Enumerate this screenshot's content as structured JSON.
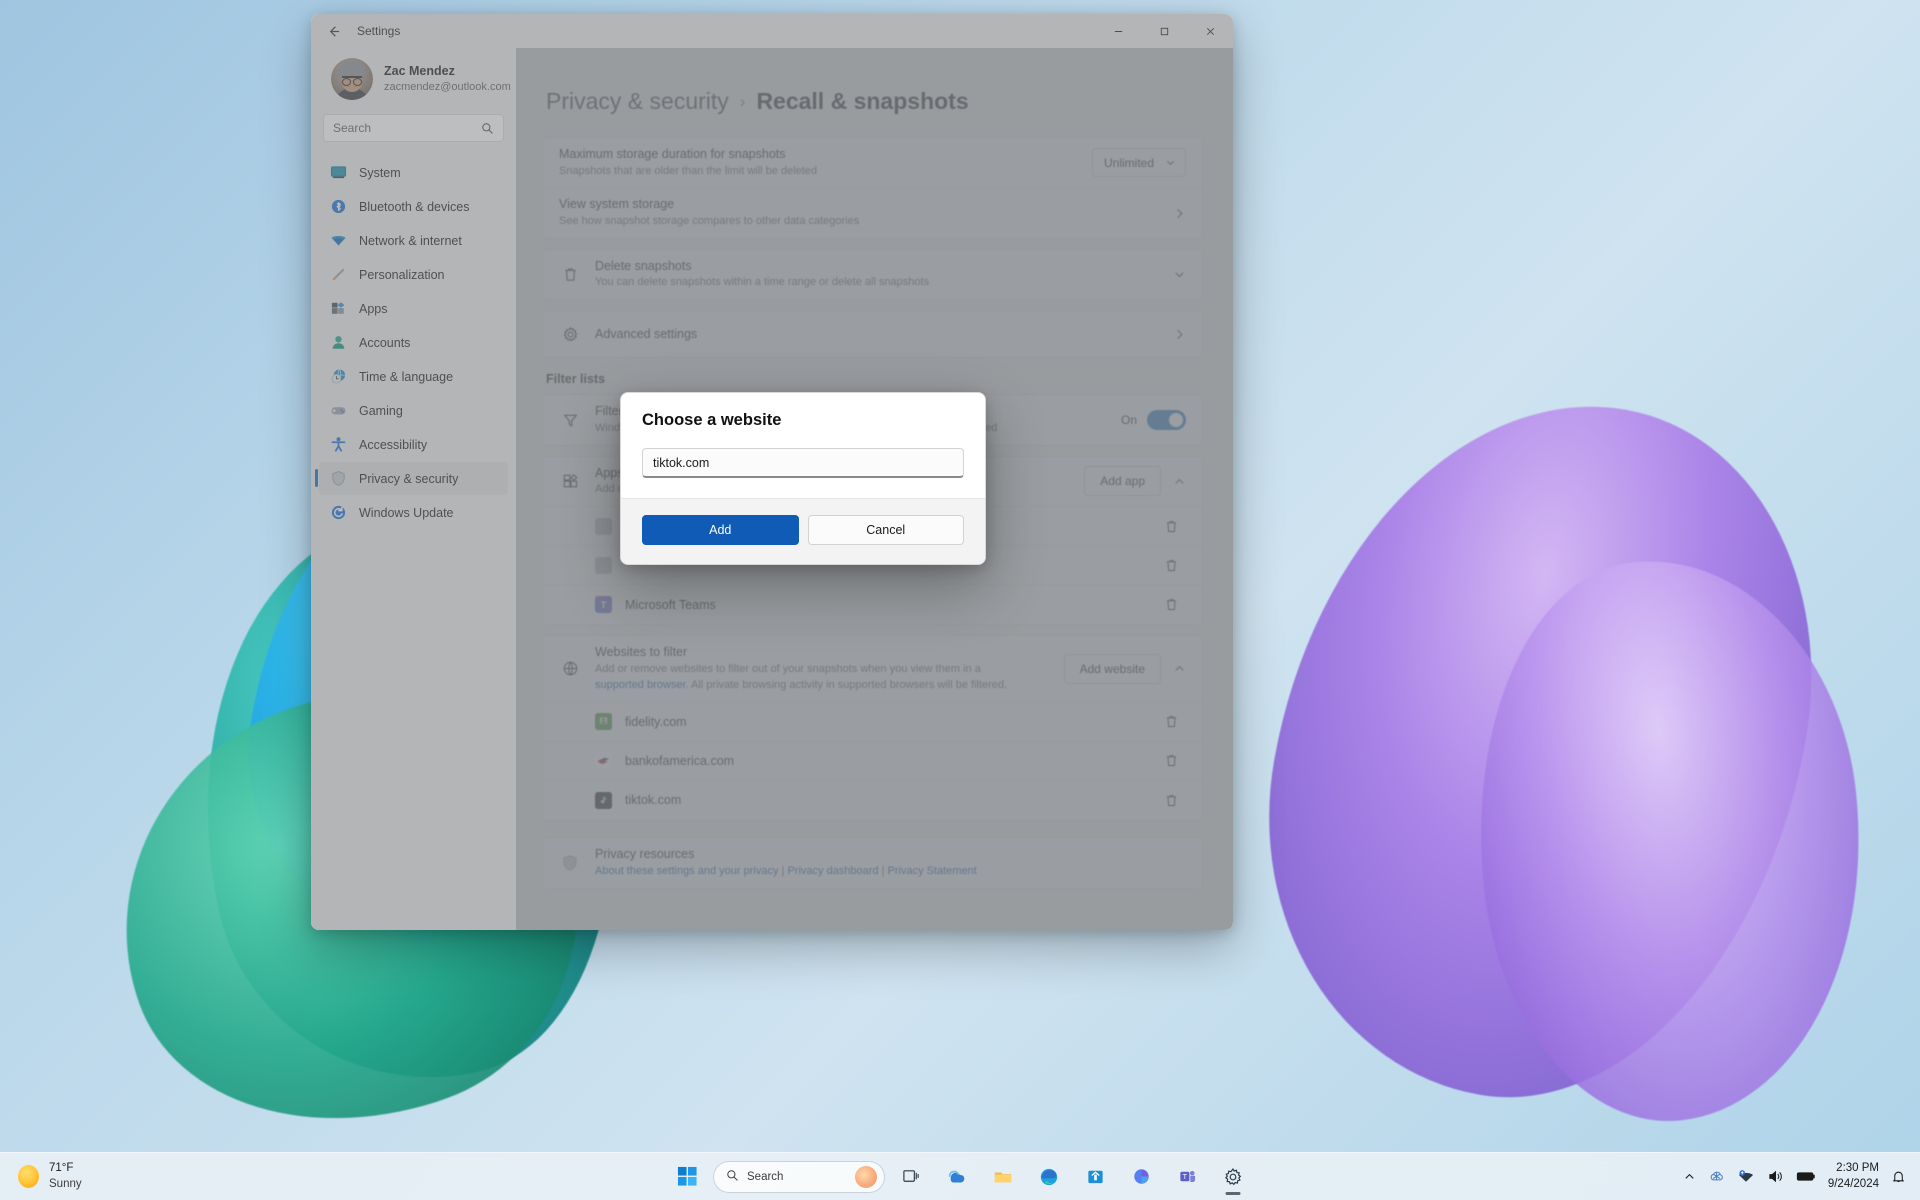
{
  "window": {
    "title": "Settings",
    "back_icon": "back-arrow-icon",
    "minimize_label": "–",
    "maximize_label": "□",
    "close_label": "✕"
  },
  "account": {
    "name": "Zac Mendez",
    "email": "zacmendez@outlook.com"
  },
  "search": {
    "placeholder": "Search",
    "icon": "search-icon"
  },
  "sidebar": {
    "items": [
      {
        "label": "System",
        "icon": "system-icon",
        "selected": false
      },
      {
        "label": "Bluetooth & devices",
        "icon": "bluetooth-icon",
        "selected": false
      },
      {
        "label": "Network & internet",
        "icon": "wifi-icon",
        "selected": false
      },
      {
        "label": "Personalization",
        "icon": "paintbrush-icon",
        "selected": false
      },
      {
        "label": "Apps",
        "icon": "apps-icon",
        "selected": false
      },
      {
        "label": "Accounts",
        "icon": "accounts-icon",
        "selected": false
      },
      {
        "label": "Time & language",
        "icon": "clock-globe-icon",
        "selected": false
      },
      {
        "label": "Gaming",
        "icon": "gamepad-icon",
        "selected": false
      },
      {
        "label": "Accessibility",
        "icon": "accessibility-icon",
        "selected": false
      },
      {
        "label": "Privacy & security",
        "icon": "shield-icon",
        "selected": true
      },
      {
        "label": "Windows Update",
        "icon": "update-icon",
        "selected": false
      }
    ]
  },
  "breadcrumb": {
    "parent": "Privacy & security",
    "separator": "›",
    "current": "Recall & snapshots"
  },
  "settings_rows": [
    {
      "title": "Maximum storage duration for snapshots",
      "subtitle": "Snapshots that are older than the limit will be deleted",
      "icon": null,
      "control": "dropdown",
      "value": "Unlimited"
    },
    {
      "title": "View system storage",
      "subtitle": "See how snapshot storage compares to other data categories",
      "icon": null,
      "control": "chevron-right"
    },
    {
      "title": "Delete snapshots",
      "subtitle": "You can delete snapshots within a time range or delete all snapshots",
      "icon": "trash-icon",
      "control": "chevron-down"
    },
    {
      "title": "Advanced settings",
      "subtitle": "",
      "icon": "gear-icon",
      "control": "chevron-right"
    }
  ],
  "filter_lists": {
    "heading": "Filter lists",
    "sensitive": {
      "title": "Filter sensitive information",
      "subtitle": "Windows will not save snapshots when potentially sensitive information is detected",
      "icon": "funnel-icon",
      "toggle_label": "On",
      "toggle_on": true
    },
    "apps": {
      "title": "Apps to filter",
      "subtitle": "Add or remove apps to filter out of your snapshots",
      "icon": "apps-grid-icon",
      "button_label": "Add app",
      "expand_icon": "chevron-up-icon",
      "items": [
        {
          "name": "Microsoft Teams",
          "icon": "teams-icon"
        }
      ]
    },
    "websites": {
      "title": "Websites to filter",
      "subtitle_line1": "Add or remove websites to filter out of your snapshots when you view them in a",
      "link_text": "supported browser",
      "subtitle_line2": ". All private browsing activity in supported browsers will be filtered.",
      "icon": "globe-icon",
      "button_label": "Add website",
      "expand_icon": "chevron-up-icon",
      "items": [
        {
          "name": "fidelity.com",
          "icon": "fidelity-favicon"
        },
        {
          "name": "bankofamerica.com",
          "icon": "bankofamerica-favicon"
        },
        {
          "name": "tiktok.com",
          "icon": "tiktok-favicon"
        }
      ]
    }
  },
  "privacy_resources": {
    "title": "Privacy resources",
    "icon": "shield-icon",
    "links": [
      "About these settings and your privacy",
      "Privacy dashboard",
      "Privacy Statement"
    ],
    "separator": "|"
  },
  "dialog": {
    "title": "Choose a website",
    "input_value": "tiktok.com",
    "primary_label": "Add",
    "secondary_label": "Cancel"
  },
  "taskbar": {
    "weather_temp": "71°F",
    "weather_condition": "Sunny",
    "weather_icon": "sun-icon",
    "start_icon": "windows-start-icon",
    "search_placeholder": "Search",
    "search_icon": "search-icon",
    "items": [
      {
        "name": "task-view-icon"
      },
      {
        "name": "copilot-icon"
      },
      {
        "name": "file-explorer-icon"
      },
      {
        "name": "edge-icon"
      },
      {
        "name": "store-icon"
      },
      {
        "name": "powerpoint-icon"
      },
      {
        "name": "teams-icon"
      },
      {
        "name": "settings-icon"
      }
    ],
    "tray": {
      "chevron_label": "⌃",
      "onedrive_icon": "onedrive-icon",
      "network_icon": "network-icon",
      "volume_icon": "volume-icon",
      "battery_icon": "battery-icon",
      "time": "2:30 PM",
      "date": "9/24/2024",
      "notification_icon": "bell-icon"
    }
  },
  "colors": {
    "accent": "#0f6cbd",
    "dialog_primary": "#0f5bb5",
    "link": "#0a53b8"
  }
}
